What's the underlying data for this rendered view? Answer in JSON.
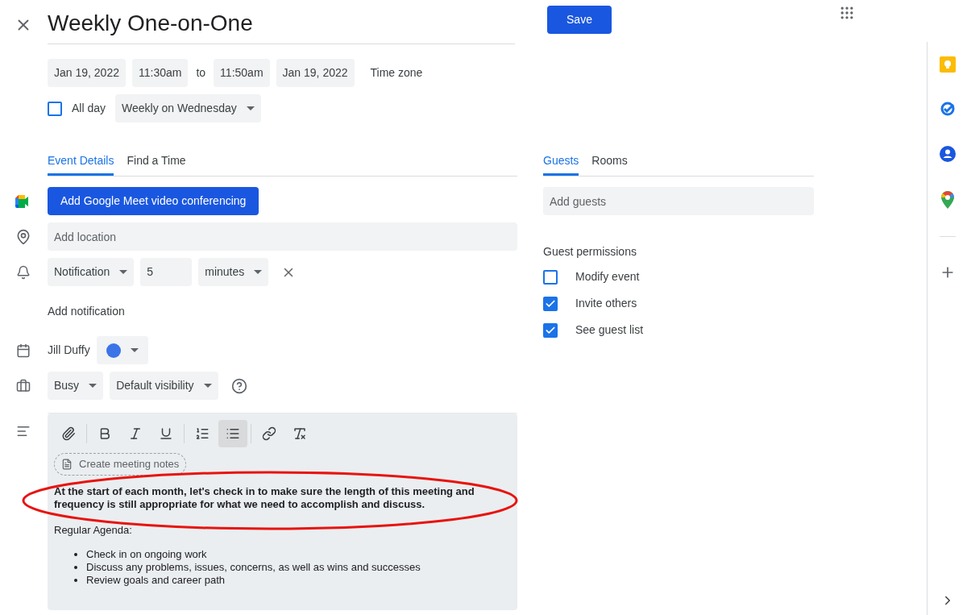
{
  "title": "Weekly One-on-One",
  "save": "Save",
  "date_row": {
    "start_date": "Jan 19, 2022",
    "start_time": "11:30am",
    "separator": "to",
    "end_time": "11:50am",
    "end_date": "Jan 19, 2022",
    "time_zone": "Time zone"
  },
  "all_day": {
    "label": "All day",
    "checked": false
  },
  "recurrence": "Weekly on Wednesday",
  "tabs": [
    {
      "label": "Event Details",
      "selected": true
    },
    {
      "label": "Find a Time",
      "selected": false
    }
  ],
  "meet_button": "Add Google Meet video conferencing",
  "location": {
    "placeholder": "Add location"
  },
  "notification": {
    "type": "Notification",
    "value": "5",
    "unit": "minutes"
  },
  "add_notification": "Add notification",
  "calendar": {
    "owner": "Jill Duffy",
    "color": "#3b73e8"
  },
  "availability": "Busy",
  "visibility": "Default visibility",
  "toolbar": [
    {
      "kind": "attach",
      "selected": false
    },
    {
      "kind": "bold",
      "selected": false
    },
    {
      "kind": "italic",
      "selected": false
    },
    {
      "kind": "underline",
      "selected": false
    },
    {
      "kind": "numbered",
      "selected": false
    },
    {
      "kind": "bulleted",
      "selected": true
    },
    {
      "kind": "link",
      "selected": false
    },
    {
      "kind": "clear",
      "selected": false
    }
  ],
  "meeting_notes": "Create meeting notes",
  "description": [
    {
      "kind": "bold",
      "text": "At the start of each month, let's check in to make sure the length of this meeting and frequency is still appropriate for what we need to accomplish and discuss."
    },
    {
      "kind": "plain",
      "text": "Regular Agenda:"
    },
    {
      "kind": "list",
      "items": [
        "Check in on ongoing work",
        "Discuss any problems, issues, concerns, as well as wins and successes",
        "Review goals and career path"
      ]
    }
  ],
  "guest_tabs": [
    {
      "label": "Guests",
      "selected": true
    },
    {
      "label": "Rooms",
      "selected": false
    }
  ],
  "guests": {
    "placeholder": "Add guests"
  },
  "permissions": {
    "title": "Guest permissions",
    "items": [
      {
        "label": "Modify event",
        "checked": false
      },
      {
        "label": "Invite others",
        "checked": true
      },
      {
        "label": "See guest list",
        "checked": true
      }
    ]
  }
}
